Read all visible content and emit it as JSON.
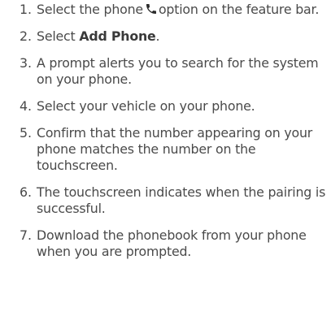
{
  "steps": [
    {
      "number": "1.",
      "before_icon": "Select the phone",
      "icon": "phone-icon",
      "after_icon": "option on the feature bar."
    },
    {
      "number": "2.",
      "prefix": "Select ",
      "emphasis": "Add Phone",
      "suffix": "."
    },
    {
      "number": "3.",
      "text": "A prompt alerts you to search for the system on your phone."
    },
    {
      "number": "4.",
      "text": "Select your vehicle on your phone."
    },
    {
      "number": "5.",
      "text": "Confirm that the number appearing on your phone matches the number on the touchscreen."
    },
    {
      "number": "6.",
      "text": "The touchscreen indicates when the pairing is successful."
    },
    {
      "number": "7.",
      "text": "Download the phonebook from your phone when you are prompted."
    }
  ],
  "colors": {
    "text": "#4a4a4a",
    "icon": "#2b2b2b"
  }
}
